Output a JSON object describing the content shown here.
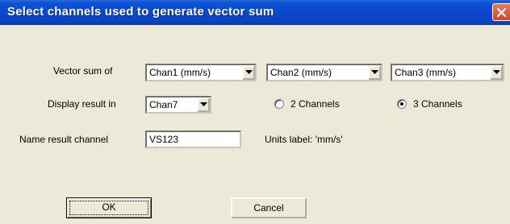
{
  "dialog": {
    "title": "Select channels used to generate vector sum",
    "labels": {
      "vector_sum_of": "Vector sum of",
      "display_result_in": "Display result in",
      "name_result_channel": "Name result channel",
      "units_label": "Units label: 'mm/s'"
    },
    "selects": {
      "chan_a": "Chan1 (mm/s)",
      "chan_b": "Chan2 (mm/s)",
      "chan_c": "Chan3 (mm/s)",
      "result_channel": "Chan7"
    },
    "radios": {
      "two_channels": "2 Channels",
      "three_channels": "3 Channels",
      "selected": "3 Channels"
    },
    "inputs": {
      "result_name": "VS123"
    },
    "buttons": {
      "ok": "OK",
      "cancel": "Cancel"
    },
    "icons": {
      "close": "close-icon",
      "dropdown": "chevron-down-icon"
    },
    "colors": {
      "titlebar": "#0a49cc",
      "close": "#d1442a",
      "face": "#ece9d8"
    }
  }
}
